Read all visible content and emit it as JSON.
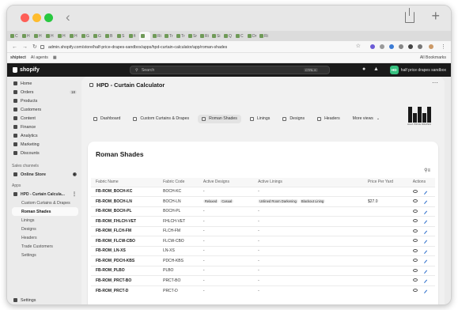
{
  "browser": {
    "tabs": [
      "C",
      "H",
      "H",
      "H",
      "H",
      "H",
      "G",
      "G",
      "B",
      "S",
      "fi",
      "",
      "Ri",
      "Tr",
      "Tr",
      "Sr",
      "Ri",
      "Si",
      "Q",
      "C",
      "Dr",
      "Ri"
    ],
    "url": "admin.shopify.com/store/half-price-drapes-sandbox/apps/hpd-curtain-calculator/app/roman-shades",
    "bookmarks": [
      "shiptect",
      "AI agents"
    ],
    "all_bookmarks": "All Bookmarks"
  },
  "shopify": {
    "logo": "shopify",
    "search_placeholder": "Search",
    "search_shortcut": "CTRL K",
    "store_initials": "HD",
    "store_name": "half price drapes sandbox"
  },
  "sidebar": {
    "items": [
      {
        "label": "Home",
        "icon": "home-icon"
      },
      {
        "label": "Orders",
        "icon": "orders-icon",
        "count": "18"
      },
      {
        "label": "Products",
        "icon": "tag-icon"
      },
      {
        "label": "Customers",
        "icon": "person-icon"
      },
      {
        "label": "Content",
        "icon": "content-icon"
      },
      {
        "label": "Finance",
        "icon": "bank-icon"
      },
      {
        "label": "Analytics",
        "icon": "chart-icon"
      },
      {
        "label": "Marketing",
        "icon": "target-icon"
      },
      {
        "label": "Discounts",
        "icon": "discount-icon"
      }
    ],
    "sales_channels": "Sales channels",
    "online_store": "Online Store",
    "apps": "Apps",
    "app_name": "HPD - Curtain Calcula...",
    "app_links": [
      "Custom Curtains & Drapes",
      "Roman Shades",
      "Linings",
      "Designs",
      "Headers",
      "Trade Customers",
      "Settings"
    ],
    "settings": "Settings"
  },
  "page": {
    "title": "HPD - Curtain Calculator",
    "nav": [
      "Dashboard",
      "Custom Curtains & Drapes",
      "Roman Shades",
      "Linings",
      "Designs",
      "Headers",
      "More views"
    ],
    "logo_caption": "HALF PRICE DRAPES",
    "card_title": "Roman Shades",
    "columns": [
      "Fabric Name",
      "Fabric Code",
      "Active Designs",
      "Active Linings",
      "Price Per Yard",
      "Actions"
    ],
    "rows": [
      {
        "name": "FB-ROM_BOCH-KC",
        "code": "BOCH-KC",
        "designs": [
          "-"
        ],
        "linings": [
          "-"
        ],
        "price": ""
      },
      {
        "name": "FB-ROM_BOCH-LN",
        "code": "BOCH-LN",
        "designs": [
          "Relaxed",
          "Casual"
        ],
        "linings": [
          "Unlined Room Darkening",
          "Blackout Lining"
        ],
        "price": "$27.0"
      },
      {
        "name": "FB-ROM_BOCH-PL",
        "code": "BOCH-PL",
        "designs": [
          "-"
        ],
        "linings": [
          "-"
        ],
        "price": ""
      },
      {
        "name": "FB-ROM_FHLCH-VET",
        "code": "FHLCH-VET",
        "designs": [
          "-"
        ],
        "linings": [
          "-"
        ],
        "price": ""
      },
      {
        "name": "FB-ROM_FLCH-FM",
        "code": "FLCH-FM",
        "designs": [
          "-"
        ],
        "linings": [
          "-"
        ],
        "price": ""
      },
      {
        "name": "FB-ROM_FLCW-CBO",
        "code": "FLCW-CBO",
        "designs": [
          "-"
        ],
        "linings": [
          "-"
        ],
        "price": ""
      },
      {
        "name": "FB-ROM_LN-XS",
        "code": "LN-XS",
        "designs": [
          "-"
        ],
        "linings": [
          "-"
        ],
        "price": ""
      },
      {
        "name": "FB-ROM_PDCH-KBS",
        "code": "PDCH-KBS",
        "designs": [
          "-"
        ],
        "linings": [
          "-"
        ],
        "price": ""
      },
      {
        "name": "FB-ROM_PLBO",
        "code": "PLBO",
        "designs": [
          "-"
        ],
        "linings": [
          "-"
        ],
        "price": ""
      },
      {
        "name": "FB-ROM_PRCT-BO",
        "code": "PRCT-BO",
        "designs": [
          "-"
        ],
        "linings": [
          "-"
        ],
        "price": ""
      },
      {
        "name": "FB-ROM_PRCT-D",
        "code": "PRCT-D",
        "designs": [
          "-"
        ],
        "linings": [
          "-"
        ],
        "price": ""
      }
    ]
  }
}
